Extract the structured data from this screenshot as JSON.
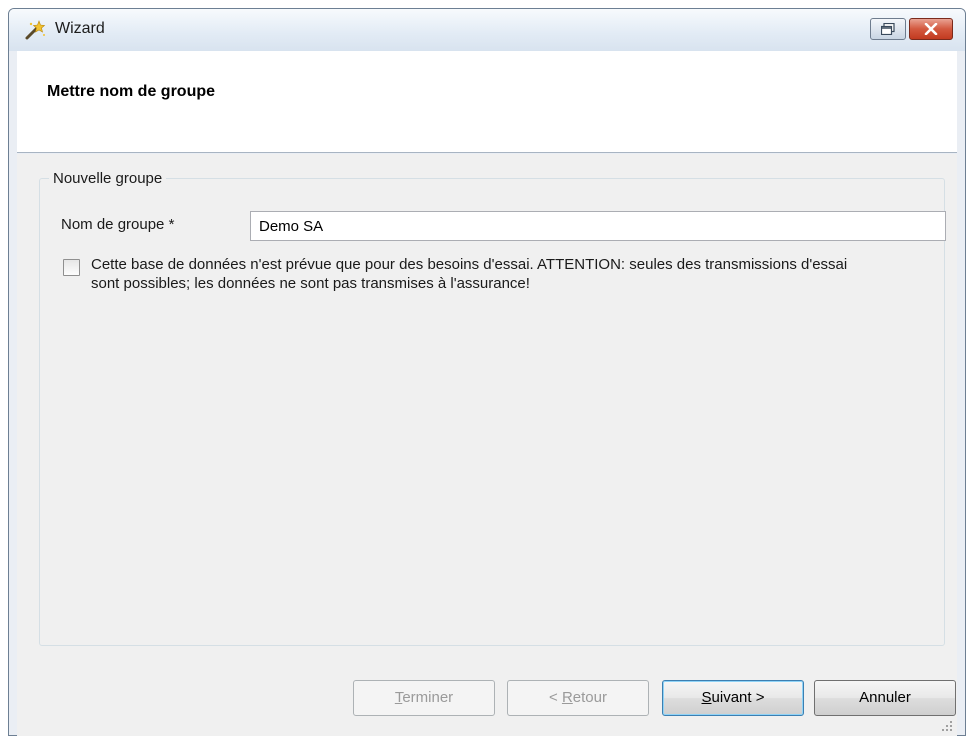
{
  "window": {
    "title": "Wizard",
    "icon": "wizard-wand-icon",
    "controls": [
      "restore-icon",
      "close-icon"
    ]
  },
  "header": {
    "title": "Mettre nom de groupe"
  },
  "group": {
    "legend": "Nouvelle groupe",
    "name_label": "Nom de groupe *",
    "name_value": "Demo SA",
    "checkbox_checked": false,
    "checkbox_text": "Cette base de données n'est prévue que pour des besoins d'essai. ATTENTION: seules des transmissions d'essai sont possibles; les données ne sont pas transmises à l'assurance!"
  },
  "buttons": {
    "terminer": {
      "prefix": "",
      "accel": "T",
      "rest": "erminer",
      "enabled": false
    },
    "retour": {
      "prefix": "< ",
      "accel": "R",
      "rest": "etour",
      "enabled": false
    },
    "suivant": {
      "prefix": "",
      "accel": "S",
      "rest": "uivant >",
      "enabled": true
    },
    "annuler": {
      "label": "Annuler",
      "enabled": true
    }
  },
  "colors": {
    "header_bg": "#ffffff",
    "content_bg": "#f0f0f0",
    "close_button": "#c23a20",
    "default_button_border": "#3c7fb1"
  }
}
